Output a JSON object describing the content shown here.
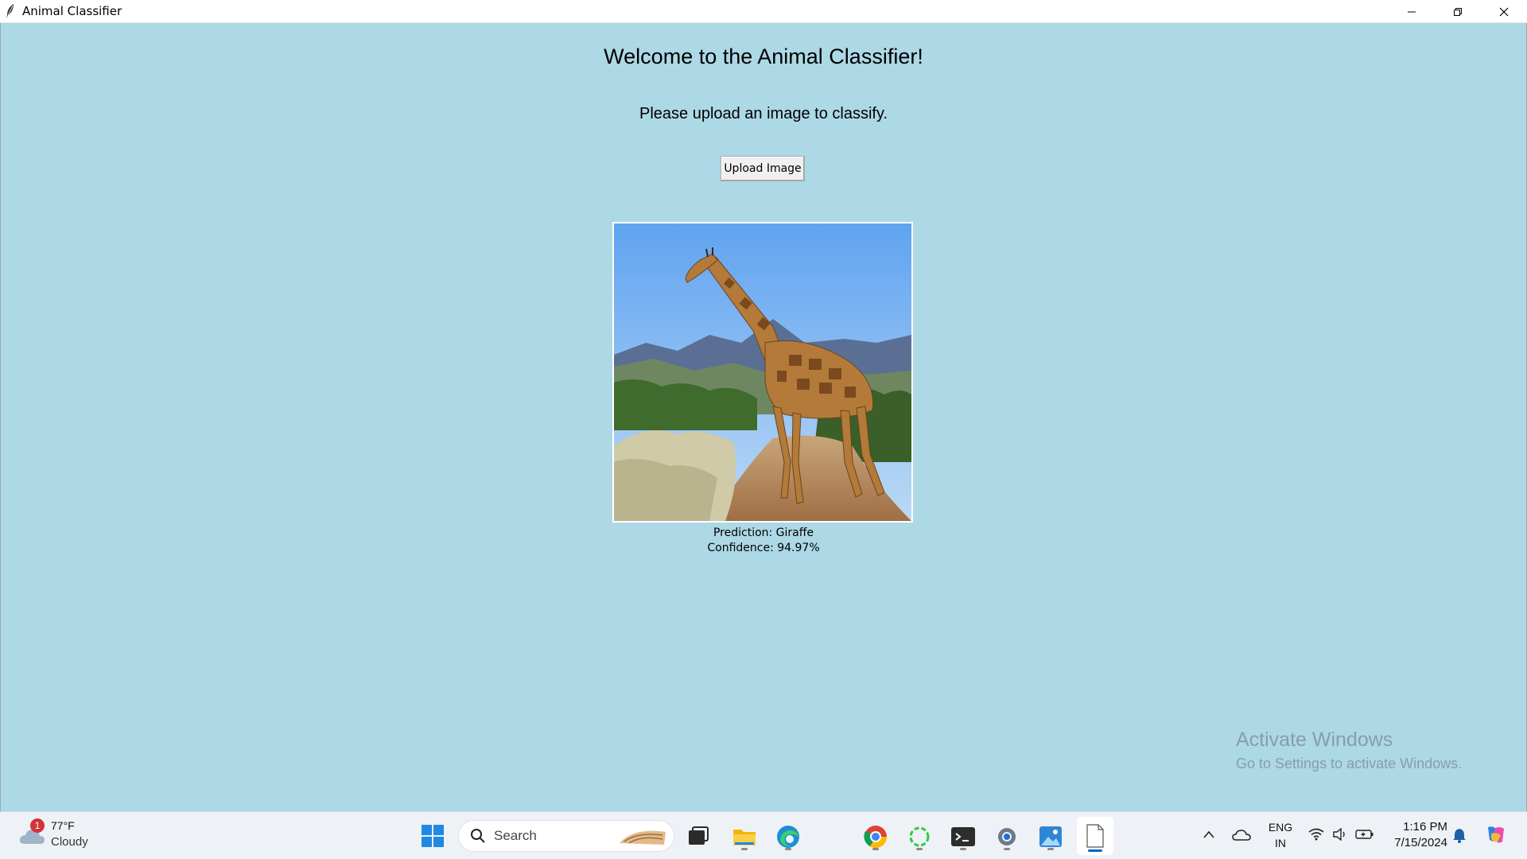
{
  "window": {
    "title": "Animal Classifier",
    "minimize_icon": "minimize-icon",
    "restore_icon": "restore-icon",
    "close_icon": "close-icon"
  },
  "main": {
    "heading": "Welcome to the Animal Classifier!",
    "instruction": "Please upload an image to classify.",
    "upload_button": "Upload Image",
    "image_subject": "giraffe-photo",
    "prediction": "Prediction: Giraffe",
    "confidence": "Confidence: 94.97%"
  },
  "watermark": {
    "line1": "Activate Windows",
    "line2": "Go to Settings to activate Windows."
  },
  "taskbar": {
    "weather": {
      "badge": "1",
      "temp": "77°F",
      "condition": "Cloudy"
    },
    "search_placeholder": "Search",
    "apps": [
      "start-icon",
      "task-view-icon",
      "file-explorer-icon",
      "edge-icon",
      "chrome-icon",
      "loading-app-icon",
      "terminal-icon",
      "settings-icon",
      "photos-icon",
      "notepad-icon"
    ],
    "tray": {
      "language_line1": "ENG",
      "language_line2": "IN",
      "time": "1:16 PM",
      "date": "7/15/2024"
    }
  },
  "colors": {
    "background": "#add8e6",
    "accent": "#0067c0"
  }
}
